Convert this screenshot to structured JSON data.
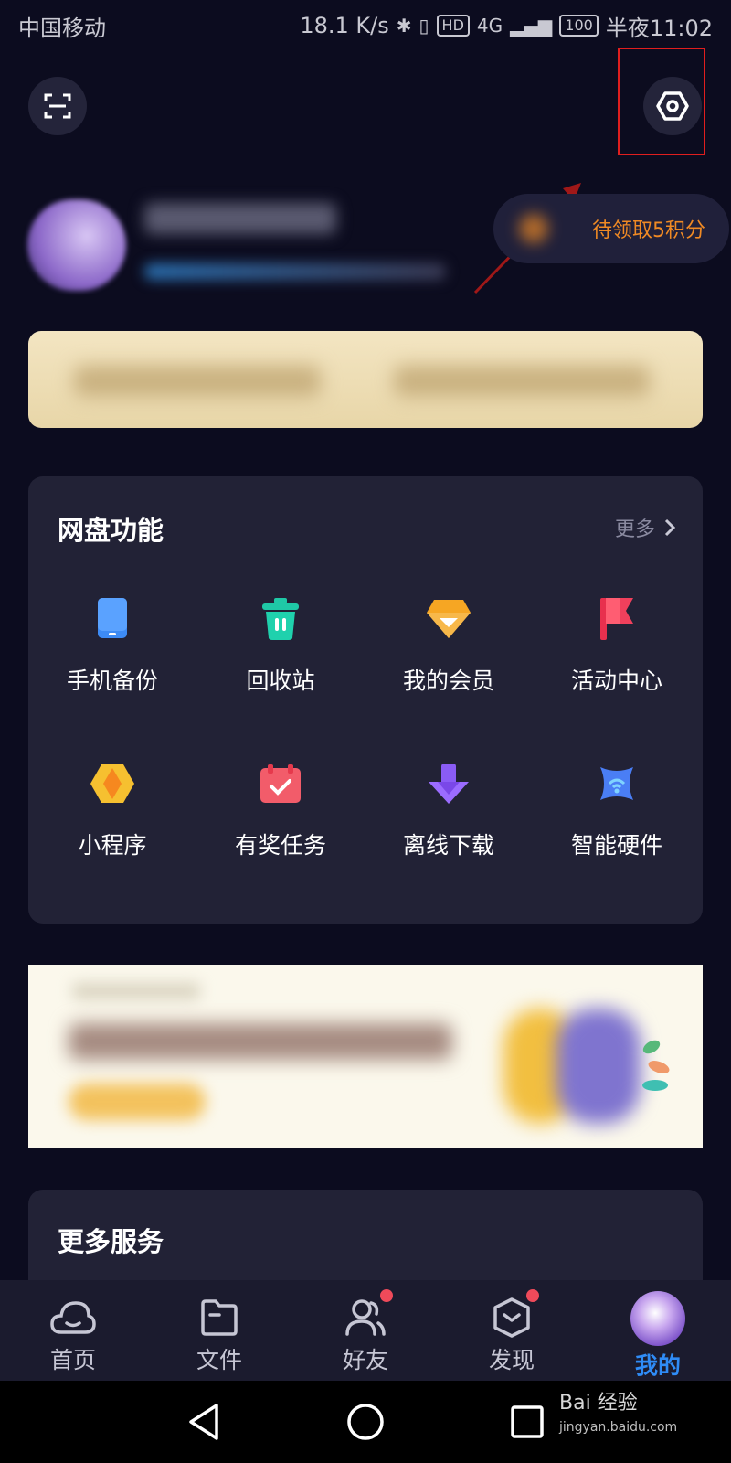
{
  "status_bar": {
    "carrier": "中国移动",
    "net_speed": "18.1 K/s",
    "hd_badge": "HD",
    "network": "4G",
    "battery": "100",
    "time": "半夜11:02"
  },
  "header": {
    "scan_icon": "scan-icon",
    "settings_icon": "settings-hexagon-icon"
  },
  "profile": {
    "points_label": "待领取5积分"
  },
  "features": {
    "title": "网盘功能",
    "more_label": "更多",
    "items": [
      {
        "label": "手机备份",
        "icon": "phone-backup-icon",
        "color": "#3d8bf5"
      },
      {
        "label": "回收站",
        "icon": "recycle-bin-icon",
        "color": "#1fc8a6"
      },
      {
        "label": "我的会员",
        "icon": "vip-diamond-icon",
        "color": "#f6a623"
      },
      {
        "label": "活动中心",
        "icon": "flag-icon",
        "color": "#f0405c"
      },
      {
        "label": "小程序",
        "icon": "mini-program-icon",
        "color": "#f6b820"
      },
      {
        "label": "有奖任务",
        "icon": "task-calendar-icon",
        "color": "#f25c6a"
      },
      {
        "label": "离线下载",
        "icon": "download-arrow-icon",
        "color": "#8a5cf5"
      },
      {
        "label": "智能硬件",
        "icon": "smart-hardware-icon",
        "color": "#4a7ef5"
      }
    ]
  },
  "services": {
    "title": "更多服务"
  },
  "tab_bar": {
    "tabs": [
      {
        "label": "首页",
        "icon": "cloud-icon",
        "badge": false,
        "active": false
      },
      {
        "label": "文件",
        "icon": "folder-icon",
        "badge": false,
        "active": false
      },
      {
        "label": "好友",
        "icon": "friends-icon",
        "badge": true,
        "active": false
      },
      {
        "label": "发现",
        "icon": "discover-box-icon",
        "badge": true,
        "active": false
      },
      {
        "label": "我的",
        "icon": "avatar",
        "badge": false,
        "active": true
      }
    ]
  },
  "watermark": {
    "brand": "Bai 经验",
    "url": "jingyan.baidu.com"
  },
  "colors": {
    "background": "#0c0c1f",
    "card": "#222236",
    "accent_orange": "#f08a24",
    "active_tab": "#2f8cf7",
    "badge_red": "#ef4a5a",
    "annotation_red": "#e01e1e"
  }
}
